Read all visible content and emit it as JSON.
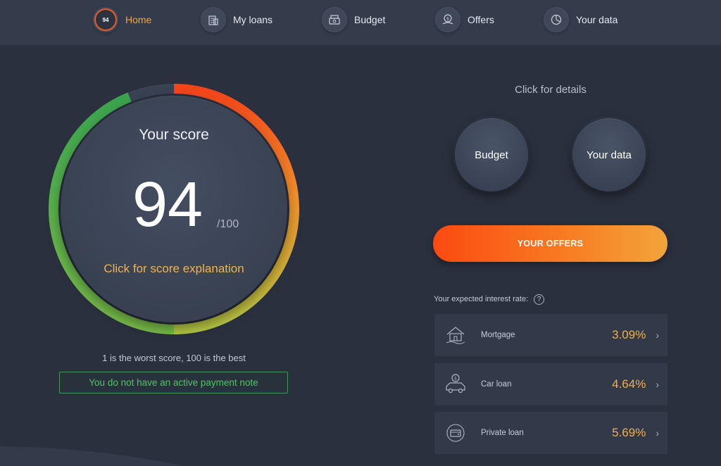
{
  "nav": {
    "score_badge": "94",
    "items": [
      {
        "label": "Home",
        "icon": "score-badge-icon",
        "active": true
      },
      {
        "label": "My loans",
        "icon": "loans-building-icon"
      },
      {
        "label": "Budget",
        "icon": "budget-icon"
      },
      {
        "label": "Offers",
        "icon": "offers-gift-icon"
      },
      {
        "label": "Your data",
        "icon": "data-chart-icon"
      }
    ]
  },
  "score": {
    "title": "Your score",
    "value": "94",
    "max": "/100",
    "score_fraction": 0.94,
    "link_text": "Click for score explanation",
    "caption": "1 is the worst score, 100 is the best",
    "payment_note": "You do not have an active payment note"
  },
  "details": {
    "title": "Click for details",
    "budget_button": "Budget",
    "data_button": "Your data",
    "offers_button": "YOUR OFFERS"
  },
  "rates": {
    "header": "Your expected interest rate:",
    "help_symbol": "?",
    "items": [
      {
        "label": "Mortgage",
        "value": "3.09%",
        "icon": "house-icon"
      },
      {
        "label": "Car loan",
        "value": "4.64%",
        "icon": "car-icon"
      },
      {
        "label": "Private loan",
        "value": "5.69%",
        "icon": "wallet-icon"
      }
    ],
    "chevron": "›"
  },
  "colors": {
    "background": "#2a303e",
    "accent_orange": "#f3a43a",
    "offers_gradient_start": "#fb4a10",
    "offers_gradient_end": "#f3a43b",
    "success_green": "#4fc467"
  }
}
